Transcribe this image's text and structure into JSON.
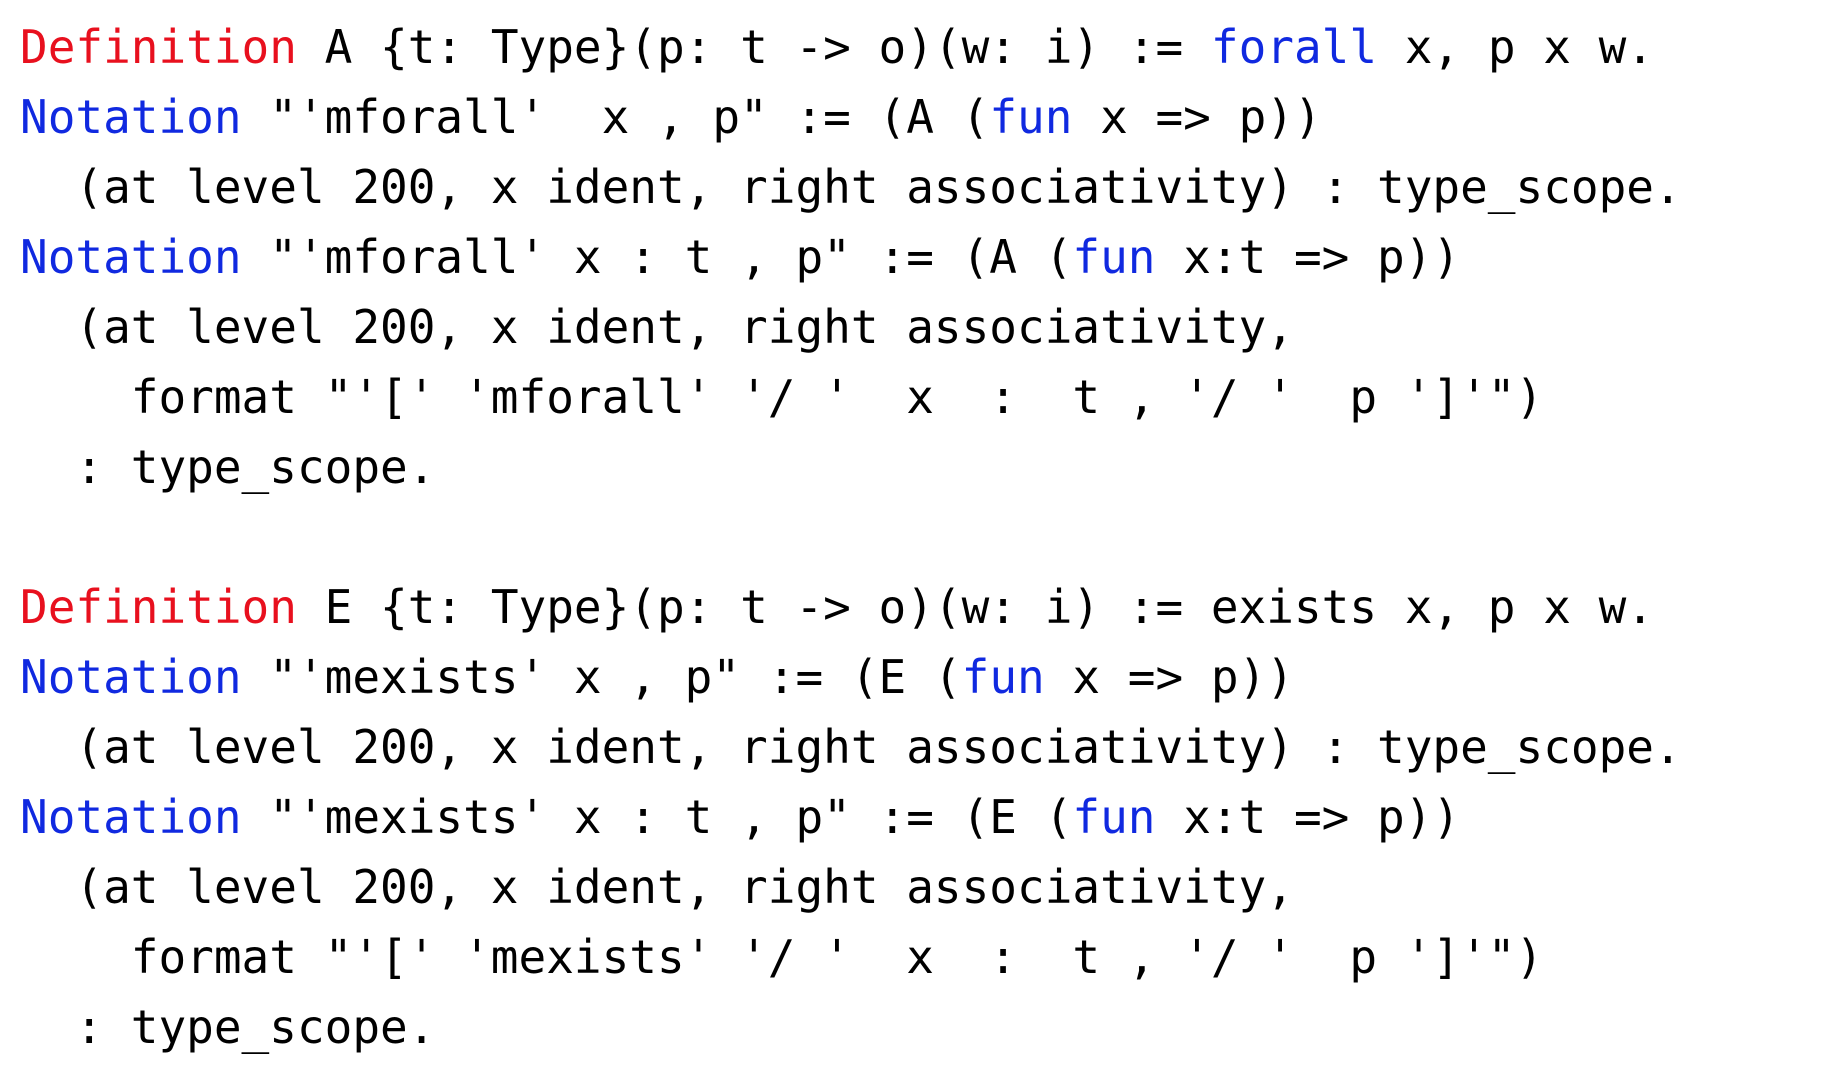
{
  "colors": {
    "definition_keyword": "#e8101e",
    "blue_keyword": "#1029e0",
    "text": "#000000",
    "background": "#ffffff"
  },
  "lines": [
    {
      "segments": [
        {
          "text": "Definition",
          "style": "red"
        },
        {
          "text": " A {t: Type}(p: t -> o)(w: i) := ",
          "style": "plain"
        },
        {
          "text": "forall",
          "style": "blue"
        },
        {
          "text": " x, p x w.",
          "style": "plain"
        }
      ]
    },
    {
      "segments": [
        {
          "text": "Notation",
          "style": "blue"
        },
        {
          "text": " \"'mforall'  x , p\" := (A (",
          "style": "plain"
        },
        {
          "text": "fun",
          "style": "blue"
        },
        {
          "text": " x => p))",
          "style": "plain"
        }
      ]
    },
    {
      "segments": [
        {
          "text": "  (at level 200, x ident, right associativity) : type_scope.",
          "style": "plain"
        }
      ]
    },
    {
      "segments": [
        {
          "text": "Notation",
          "style": "blue"
        },
        {
          "text": " \"'mforall' x : t , p\" := (A (",
          "style": "plain"
        },
        {
          "text": "fun",
          "style": "blue"
        },
        {
          "text": " x:t => p))",
          "style": "plain"
        }
      ]
    },
    {
      "segments": [
        {
          "text": "  (at level 200, x ident, right associativity,",
          "style": "plain"
        }
      ]
    },
    {
      "segments": [
        {
          "text": "    format \"'[' 'mforall' '/ '  x  :  t , '/ '  p ']'\")",
          "style": "plain"
        }
      ]
    },
    {
      "segments": [
        {
          "text": "  : type_scope.",
          "style": "plain"
        }
      ]
    },
    {
      "segments": []
    },
    {
      "segments": [
        {
          "text": "Definition",
          "style": "red"
        },
        {
          "text": " E {t: Type}(p: t -> o)(w: i) := exists x, p x w.",
          "style": "plain"
        }
      ]
    },
    {
      "segments": [
        {
          "text": "Notation",
          "style": "blue"
        },
        {
          "text": " \"'mexists' x , p\" := (E (",
          "style": "plain"
        },
        {
          "text": "fun",
          "style": "blue"
        },
        {
          "text": " x => p))",
          "style": "plain"
        }
      ]
    },
    {
      "segments": [
        {
          "text": "  (at level 200, x ident, right associativity) : type_scope.",
          "style": "plain"
        }
      ]
    },
    {
      "segments": [
        {
          "text": "Notation",
          "style": "blue"
        },
        {
          "text": " \"'mexists' x : t , p\" := (E (",
          "style": "plain"
        },
        {
          "text": "fun",
          "style": "blue"
        },
        {
          "text": " x:t => p))",
          "style": "plain"
        }
      ]
    },
    {
      "segments": [
        {
          "text": "  (at level 200, x ident, right associativity,",
          "style": "plain"
        }
      ]
    },
    {
      "segments": [
        {
          "text": "    format \"'[' 'mexists' '/ '  x  :  t , '/ '  p ']'\")",
          "style": "plain"
        }
      ]
    },
    {
      "segments": [
        {
          "text": "  : type_scope.",
          "style": "plain"
        }
      ]
    }
  ]
}
